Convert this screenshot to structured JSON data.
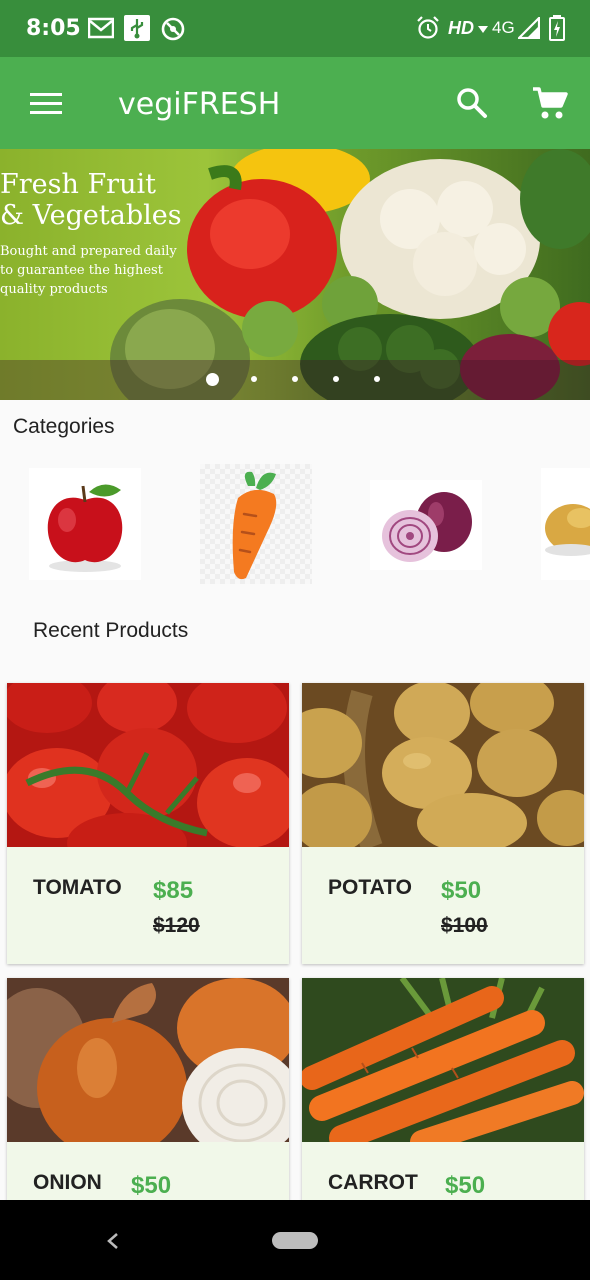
{
  "status_bar": {
    "time": "8:05",
    "network": "HD",
    "signal": "4G"
  },
  "app_bar": {
    "title": "vegiFRESH"
  },
  "banner": {
    "headline_line1": "Fresh Fruit",
    "headline_line2": "& Vegetables",
    "sub_line1": "Bought and prepared daily",
    "sub_line2": "to guarantee the highest",
    "sub_line3": "quality products"
  },
  "categories": {
    "title": "Categories"
  },
  "recent": {
    "title": "Recent Products"
  },
  "products": [
    {
      "name": "TOMATO",
      "price": "$85",
      "old_price": "$120"
    },
    {
      "name": "POTATO",
      "price": "$50",
      "old_price": "$100"
    },
    {
      "name": "ONION",
      "price": "$50"
    },
    {
      "name": "CARROT",
      "price": "$50"
    }
  ],
  "colors": {
    "primary": "#4caf50",
    "primary_dark": "#388e3c",
    "card_bg": "#f1f8e9",
    "price": "#4caf50"
  }
}
